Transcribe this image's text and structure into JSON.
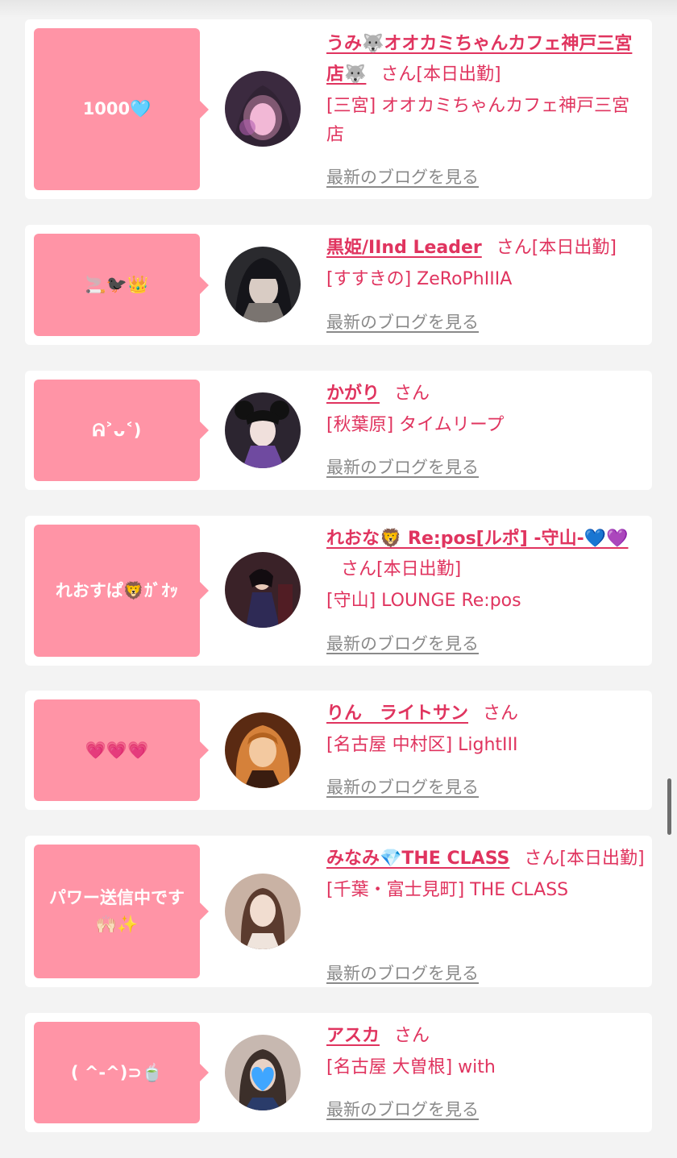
{
  "cards": [
    {
      "message": "1000🩵",
      "name": "うみ🐺オオカミちゃんカフェ神戸三宮店🐺",
      "suffix": "さん[本日出勤]",
      "shop": "[三宮] オオカミちゃんカフェ神戸三宮店",
      "blog": "最新のブログを見る",
      "avatar_colors": [
        "#3b2a3f",
        "#e9a0c8",
        "#b25fb0"
      ]
    },
    {
      "message": "🚬🐦‍⬛👑",
      "name": "黒姫/IInd Leader",
      "suffix": "さん[本日出勤]",
      "shop": "[すすきの] ZeRoPhIIIA",
      "blog": "最新のブログを見る",
      "avatar_colors": [
        "#2a2a2e",
        "#7a7470",
        "#d9ccc4"
      ]
    },
    {
      "message": "ᕱ˃ᴗ˂)",
      "name": "かがり",
      "suffix": "さん",
      "shop": "[秋葉原] タイムリープ",
      "blog": "最新のブログを見る",
      "avatar_colors": [
        "#2c2530",
        "#6f4aa0",
        "#f0e0dc"
      ]
    },
    {
      "message": "れおすぱ🦁ｶﾞｵｯ",
      "name": "れおな🦁 Re:pos[ルポ] -守山-💙💜",
      "suffix": "さん[本日出勤]",
      "shop": "[守山] LOUNGE Re:pos",
      "blog": "最新のブログを見る",
      "avatar_colors": [
        "#3a2228",
        "#2e2a55",
        "#e8c9b8"
      ]
    },
    {
      "message": "💗💗💗",
      "name": "りん　ライトサン",
      "suffix": "さん",
      "shop": "[名古屋 中村区] LightIII",
      "blog": "最新のブログを見る",
      "avatar_colors": [
        "#5a2a12",
        "#d5813a",
        "#f3c9a0"
      ]
    },
    {
      "message": "パワー送信中です🙌🏻✨",
      "name": "みなみ💎THE CLASS",
      "suffix": "さん[本日出勤]",
      "shop": "[千葉・富士見町] THE CLASS",
      "blog": "最新のブログを見る",
      "avatar_colors": [
        "#c9b2a4",
        "#5b3b2e",
        "#f1ddd0"
      ]
    },
    {
      "message": "( ^-^)⊃🍵",
      "name": "アスカ",
      "suffix": "さん",
      "shop": "[名古屋 大曽根] with",
      "blog": "最新のブログを見る",
      "avatar_colors": [
        "#3c2f2a",
        "#3fa6ff",
        "#c7b8b0"
      ]
    }
  ]
}
